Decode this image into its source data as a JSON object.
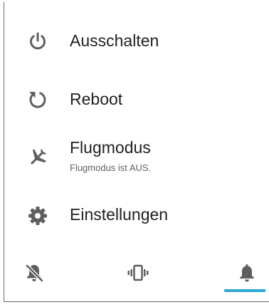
{
  "menu": {
    "items": [
      {
        "id": "power",
        "icon": "power-icon",
        "label": "Ausschalten"
      },
      {
        "id": "reboot",
        "icon": "restart-icon",
        "label": "Reboot"
      },
      {
        "id": "airplane",
        "icon": "airplane-icon",
        "label": "Flugmodus",
        "sublabel": "Flugmodus ist AUS."
      },
      {
        "id": "settings",
        "icon": "gear-icon",
        "label": "Einstellungen"
      }
    ]
  },
  "ringer": {
    "modes": [
      {
        "id": "silent",
        "icon": "bell-off-icon",
        "selected": false
      },
      {
        "id": "vibrate",
        "icon": "vibrate-icon",
        "selected": false
      },
      {
        "id": "sound",
        "icon": "bell-icon",
        "selected": true
      }
    ],
    "accent_color": "#2ea6d8"
  },
  "colors": {
    "icon": "#5f5f5f",
    "text_primary": "#212121",
    "text_secondary": "#5f5f5f"
  }
}
